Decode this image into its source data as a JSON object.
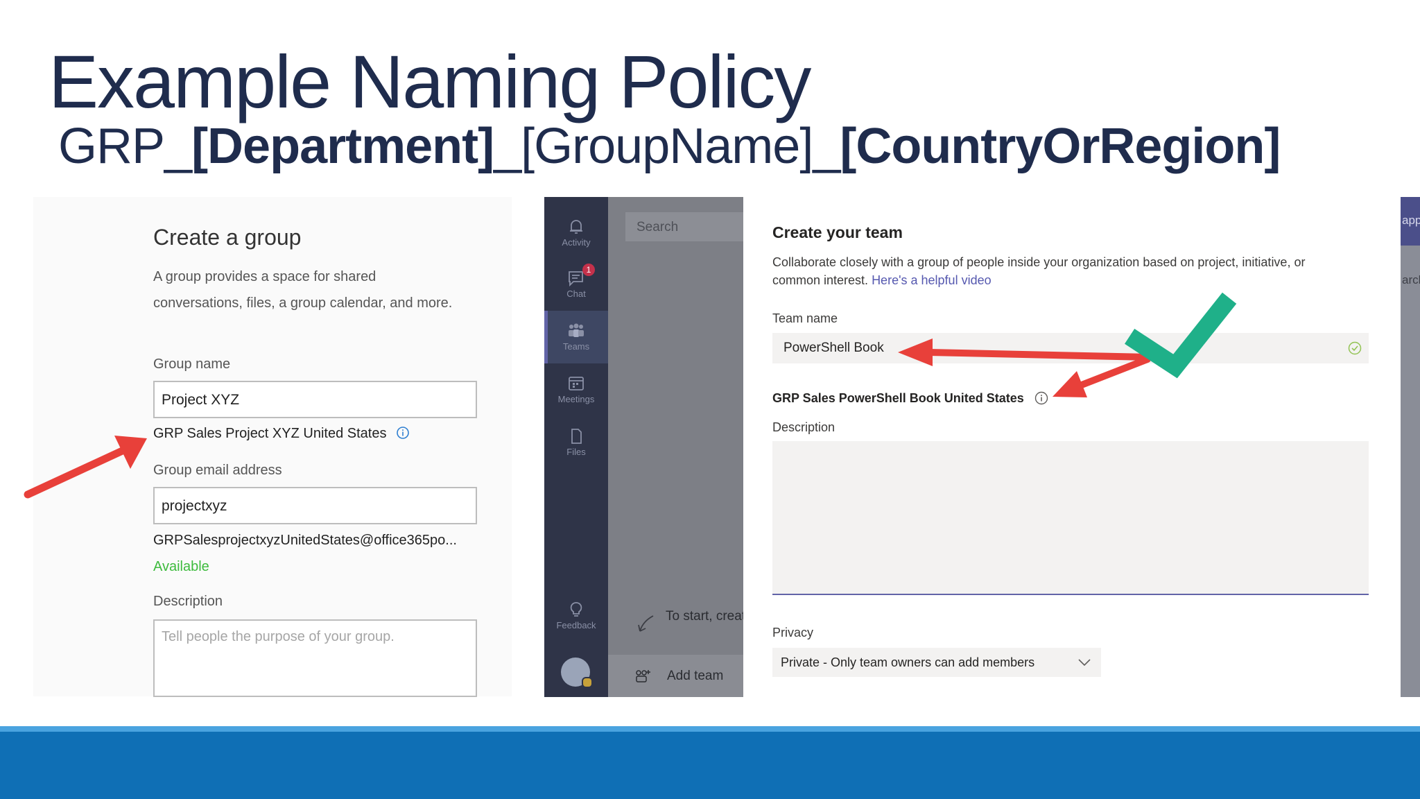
{
  "slide": {
    "title": "Example Naming Policy",
    "subtitle_parts": [
      "GRP_",
      "[Department]",
      "_[GroupName]_",
      "[CountryOrRegion]"
    ]
  },
  "create_group": {
    "heading": "Create a group",
    "description_line1": "A group provides a space for shared",
    "description_line2": "conversations, files, a group calendar, and more.",
    "group_name_label": "Group name",
    "group_name_value": "Project XYZ",
    "name_preview": "GRP Sales Project XYZ United States",
    "email_label": "Group email address",
    "email_value": "projectxyz",
    "email_preview": "GRPSalesprojectxyzUnitedStates@office365po...",
    "availability": "Available",
    "description_label": "Description",
    "description_placeholder": "Tell people the purpose of your group."
  },
  "teams_rail": {
    "items": [
      {
        "label": "Activity",
        "icon": "bell-icon"
      },
      {
        "label": "Chat",
        "icon": "chat-icon",
        "badge": "1"
      },
      {
        "label": "Teams",
        "icon": "teams-icon"
      },
      {
        "label": "Meetings",
        "icon": "calendar-icon"
      },
      {
        "label": "Files",
        "icon": "file-icon"
      }
    ],
    "feedback_label": "Feedback"
  },
  "teams_list": {
    "search_placeholder": "Search",
    "hint": "To start, creat",
    "add_team": "Add team"
  },
  "create_team": {
    "heading": "Create your team",
    "description_line1": "Collaborate closely with a group of people inside your organization based on project, initiative, or",
    "description_line2_prefix": "common interest. ",
    "helpful_video_link": "Here's a helpful video",
    "team_name_label": "Team name",
    "team_name_value": "PowerShell Book",
    "name_preview": "GRP Sales PowerShell Book United States",
    "description_label": "Description",
    "privacy_label": "Privacy",
    "privacy_value": "Private - Only team owners can add members"
  },
  "far_right": {
    "top_fragment": "app",
    "search_fragment": "arch"
  },
  "colors": {
    "title": "#1f2c4d",
    "arrow": "#e8403a",
    "check": "#1fb089",
    "footer": "#0f6fb5",
    "available": "#3dbb3d",
    "link": "#5558af"
  }
}
